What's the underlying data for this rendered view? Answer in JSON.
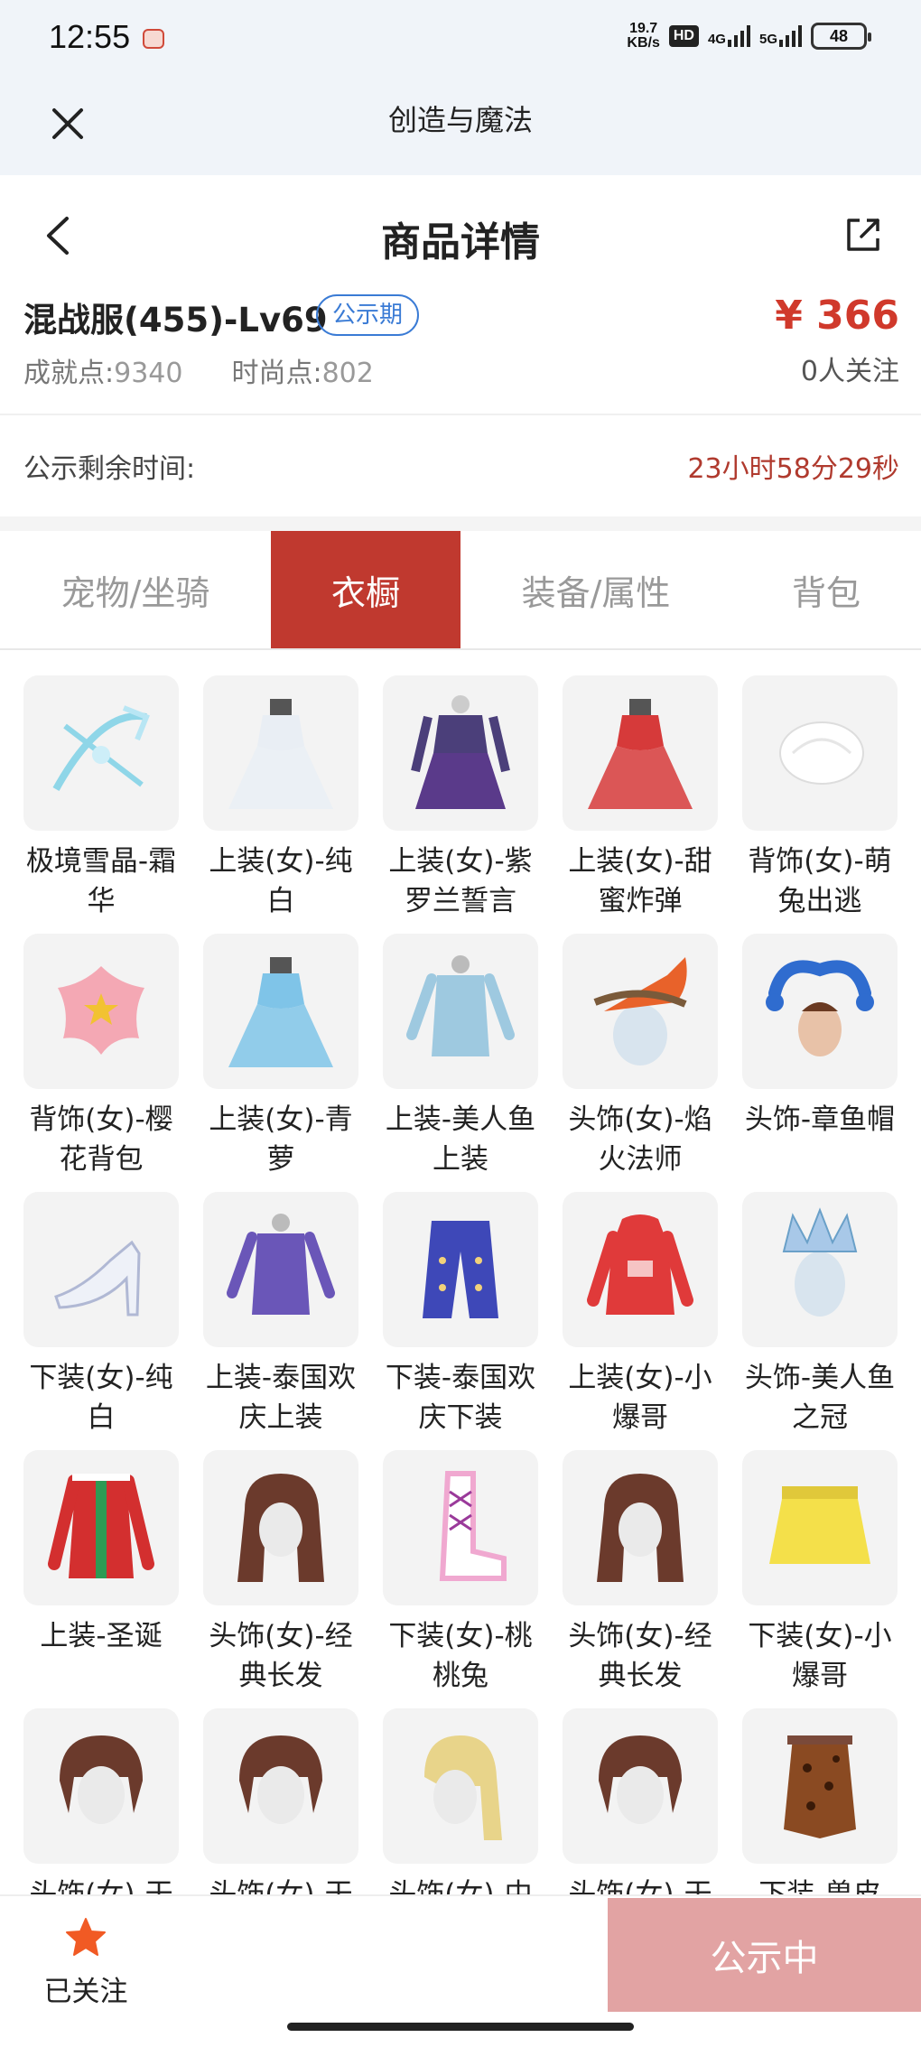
{
  "status_bar": {
    "time": "12:55",
    "speed_top": "19.7",
    "speed_bottom": "KB/s",
    "hd": "HD",
    "net1": "4G",
    "net2": "5G",
    "battery": "48"
  },
  "title_bar": {
    "title": "创造与魔法"
  },
  "page_header": {
    "title": "商品详情"
  },
  "product": {
    "name": "混战服(455)-Lv69",
    "badge": "公示期",
    "price": "¥ 366",
    "achievement_label": "成就点:",
    "achievement_value": "9340",
    "fashion_label": "时尚点:",
    "fashion_value": "802",
    "followers": "0人关注",
    "remaining_label": "公示剩余时间:",
    "remaining_value": "23小时58分29秒"
  },
  "tabs": [
    {
      "label": "宠物/坐骑",
      "active": false
    },
    {
      "label": "衣橱",
      "active": true
    },
    {
      "label": "装备/属性",
      "active": false
    },
    {
      "label": "背包",
      "active": false
    }
  ],
  "wardrobe": [
    {
      "name": "极境雪晶-霜华",
      "icon": "crossbow-icon",
      "color": "#8fd6e8"
    },
    {
      "name": "上装(女)-纯白",
      "icon": "gown-icon",
      "color": "#e9eef4"
    },
    {
      "name": "上装(女)-紫罗兰誓言",
      "icon": "armor-dress-icon",
      "color": "#4b3f7a"
    },
    {
      "name": "上装(女)-甜蜜炸弹",
      "icon": "gown-icon",
      "color": "#d63a3a"
    },
    {
      "name": "背饰(女)-萌兔出逃",
      "icon": "fluff-icon",
      "color": "#ffffff"
    },
    {
      "name": "背饰(女)-樱花背包",
      "icon": "flower-bag-icon",
      "color": "#f4a8b4"
    },
    {
      "name": "上装(女)-青萝",
      "icon": "gown-icon",
      "color": "#7fc4e8"
    },
    {
      "name": "上装-美人鱼上装",
      "icon": "torso-icon",
      "color": "#9ec9e0"
    },
    {
      "name": "头饰(女)-焰火法师",
      "icon": "flame-hat-icon",
      "color": "#e8622a"
    },
    {
      "name": "头饰-章鱼帽",
      "icon": "octopus-hat-icon",
      "color": "#2f6ccf"
    },
    {
      "name": "下装(女)-纯白",
      "icon": "heel-icon",
      "color": "#eef1f8"
    },
    {
      "name": "上装-泰国欢庆上装",
      "icon": "torso-icon",
      "color": "#6a56b8"
    },
    {
      "name": "下装-泰国欢庆下装",
      "icon": "pants-icon",
      "color": "#3e48b8"
    },
    {
      "name": "上装(女)-小爆哥",
      "icon": "hoodie-icon",
      "color": "#e03a3a"
    },
    {
      "name": "头饰-美人鱼之冠",
      "icon": "crown-head-icon",
      "color": "#a8c8e8"
    },
    {
      "name": "上装-圣诞",
      "icon": "coat-icon",
      "color": "#d32f2f"
    },
    {
      "name": "头饰(女)-经典长发",
      "icon": "hair-long-icon",
      "color": "#6b3a2c"
    },
    {
      "name": "下装(女)-桃桃兔",
      "icon": "boot-icon",
      "color": "#f0a8d0"
    },
    {
      "name": "头饰(女)-经典长发",
      "icon": "hair-long-icon",
      "color": "#6b3a2c"
    },
    {
      "name": "下装(女)-小爆哥",
      "icon": "skirt-icon",
      "color": "#f4e04a"
    },
    {
      "name": "头饰(女)-干",
      "icon": "hair-short-icon",
      "color": "#6b3a2c"
    },
    {
      "name": "头饰(女)-干",
      "icon": "hair-short-icon",
      "color": "#6b3a2c"
    },
    {
      "name": "头饰(女)-中",
      "icon": "hair-ponytail-icon",
      "color": "#e8d48a"
    },
    {
      "name": "头饰(女)-干",
      "icon": "hair-short-icon",
      "color": "#6b3a2c"
    },
    {
      "name": "下装-兽皮",
      "icon": "fur-skirt-icon",
      "color": "#8a4a22"
    }
  ],
  "bottom_bar": {
    "follow_label": "已关注",
    "public_button": "公示中"
  },
  "colors": {
    "accent_red": "#c0392f",
    "price_red": "#d0392b",
    "badge_blue": "#3a7bd5",
    "button_pink": "#e2a3a3"
  }
}
